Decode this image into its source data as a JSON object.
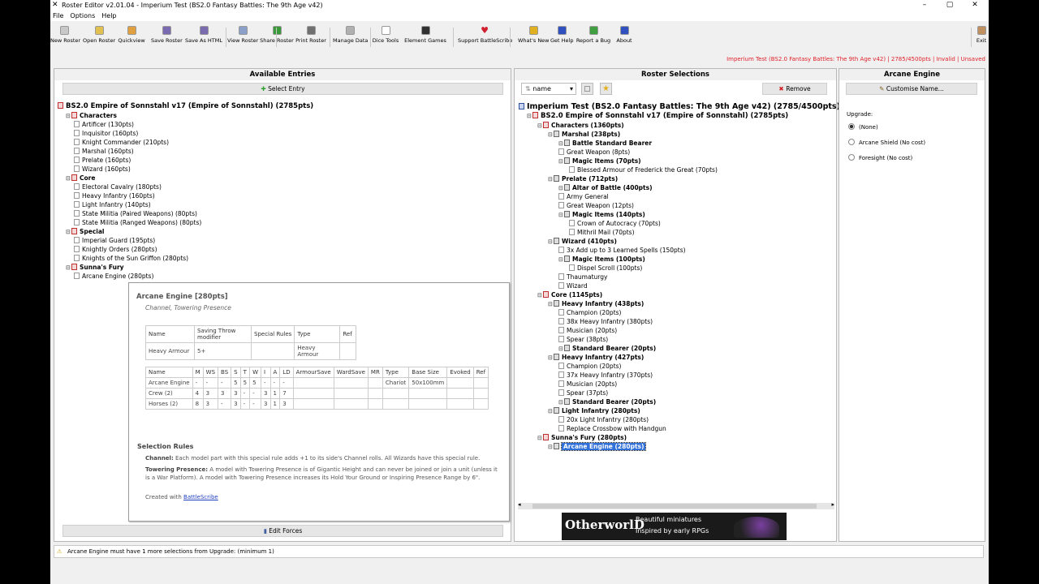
{
  "window": {
    "title": "Roster Editor v2.01.04 - Imperium Test (BS2.0 Fantasy Battles: The 9th Age v42)"
  },
  "menu": [
    "File",
    "Options",
    "Help"
  ],
  "toolbar": [
    {
      "label": "New Roster",
      "icon": "new-roster-icon",
      "color": "#c8c8c8"
    },
    {
      "label": "Open Roster",
      "icon": "folder-icon",
      "color": "#e2c050"
    },
    {
      "label": "Quickview",
      "icon": "quickview-icon",
      "color": "#e0a040"
    },
    {
      "label": "Save Roster",
      "icon": "save-icon",
      "color": "#7a6ab0"
    },
    {
      "label": "Save As HTML",
      "icon": "save-html-icon",
      "color": "#7a6ab0"
    },
    {
      "label": "View Roster",
      "icon": "view-roster-icon",
      "color": "#8aa0c8"
    },
    {
      "label": "Share Roster",
      "icon": "share-icon",
      "color": "#3a9a3a"
    },
    {
      "label": "Print Roster",
      "icon": "print-icon",
      "color": "#707070"
    },
    {
      "label": "Manage Data",
      "icon": "manage-data-icon",
      "color": "#b0b0b0"
    },
    {
      "label": "Dice Tools",
      "icon": "dice-icon",
      "color": "#ffffff"
    },
    {
      "label": "Element Games",
      "icon": "element-games-icon",
      "color": "#303030"
    },
    {
      "label": "Support BattleScribe",
      "icon": "heart-icon",
      "color": "#d02030"
    },
    {
      "label": "What's New",
      "icon": "whats-new-icon",
      "color": "#e0b020"
    },
    {
      "label": "Get Help",
      "icon": "help-icon",
      "color": "#3050c0"
    },
    {
      "label": "Report a Bug",
      "icon": "bug-icon",
      "color": "#40a040"
    },
    {
      "label": "About",
      "icon": "about-icon",
      "color": "#3050c0"
    },
    {
      "label": "Exit",
      "icon": "exit-icon",
      "color": "#c09060"
    }
  ],
  "status": "Imperium Test (BS2.0 Fantasy Battles: The 9th Age v42) | 2785/4500pts | Invalid | Unsaved",
  "available": {
    "header": "Available Entries",
    "select_button": "Select Entry",
    "root": "BS2.0 Empire of Sonnstahl v17 (Empire of Sonnstahl) (2785pts)",
    "rows": [
      {
        "text": "Characters",
        "bold": true,
        "indent": 1
      },
      {
        "text": "Artificer (130pts)",
        "indent": 2
      },
      {
        "text": "Inquisitor (160pts)",
        "indent": 2
      },
      {
        "text": "Knight Commander (210pts)",
        "indent": 2
      },
      {
        "text": "Marshal (160pts)",
        "indent": 2
      },
      {
        "text": "Prelate (160pts)",
        "indent": 2
      },
      {
        "text": "Wizard (160pts)",
        "indent": 2
      },
      {
        "text": "Core",
        "bold": true,
        "indent": 1
      },
      {
        "text": "Electoral Cavalry (180pts)",
        "indent": 2
      },
      {
        "text": "Heavy Infantry (160pts)",
        "indent": 2
      },
      {
        "text": "Light Infantry (140pts)",
        "indent": 2
      },
      {
        "text": "State Militia (Paired Weapons) (80pts)",
        "indent": 2
      },
      {
        "text": "State Militia (Ranged Weapons) (80pts)",
        "indent": 2
      },
      {
        "text": "Special",
        "bold": true,
        "indent": 1
      },
      {
        "text": "Imperial Guard (195pts)",
        "indent": 2
      },
      {
        "text": "Knightly Orders (280pts)",
        "indent": 2
      },
      {
        "text": "Knights of the Sun Griffon (280pts)",
        "indent": 2
      },
      {
        "text": "Sunna's Fury",
        "bold": true,
        "indent": 1
      },
      {
        "text": "Arcane Engine (280pts)",
        "indent": 2
      }
    ],
    "edit_forces": "Edit Forces"
  },
  "tooltip": {
    "title": "Arcane Engine [280pts]",
    "subtitle": "Channel, Towering Presence",
    "armour_headers": [
      "Name",
      "Saving Throw modifier",
      "Special Rules",
      "Type",
      "Ref"
    ],
    "armour_row": [
      "Heavy Armour",
      "5+",
      "",
      "Heavy Armour",
      ""
    ],
    "model_headers": [
      "Name",
      "M",
      "WS",
      "BS",
      "S",
      "T",
      "W",
      "I",
      "A",
      "LD",
      "ArmourSave",
      "WardSave",
      "MR",
      "Type",
      "Base Size",
      "Evoked",
      "Ref"
    ],
    "model_rows": [
      [
        "Arcane Engine",
        "-",
        "-",
        "-",
        "5",
        "5",
        "5",
        "-",
        "-",
        "-",
        "",
        "",
        "",
        "Chariot",
        "50x100mm",
        "",
        ""
      ],
      [
        "Crew (2)",
        "4",
        "3",
        "3",
        "3",
        "-",
        "-",
        "3",
        "1",
        "7",
        "",
        "",
        "",
        "",
        "",
        "",
        ""
      ],
      [
        "Horses (2)",
        "8",
        "3",
        "-",
        "3",
        "-",
        "-",
        "3",
        "1",
        "3",
        "",
        "",
        "",
        "",
        "",
        "",
        ""
      ]
    ],
    "rules_header": "Selection Rules",
    "rules": [
      {
        "name": "Channel:",
        "text": " Each model part with this special rule adds +1 to its side's Channel rolls. All Wizards have this special rule."
      },
      {
        "name": "Towering Presence:",
        "text": " A model with Towering Presence is of Gigantic Height and can never be joined or join a unit (unless it is a War Platform). A model with Towering Presence increases its Hold Your Ground or Inspiring Presence Range by 6\"."
      }
    ],
    "created_with": "Created with",
    "created_link": "BattleScribe"
  },
  "roster": {
    "header": "Roster Selections",
    "sort_value": "name",
    "remove_button": "Remove",
    "title": "Imperium Test (BS2.0 Fantasy Battles: The 9th Age v42) (2785/4500pts)",
    "force": "BS2.0 Empire of Sonnstahl v17 (Empire of Sonnstahl) (2785pts)",
    "rows": [
      {
        "text": "Characters (1360pts)",
        "bold": true,
        "indent": 1
      },
      {
        "text": "Marshal (238pts)",
        "bold": true,
        "indent": 2
      },
      {
        "text": "Battle Standard Bearer",
        "bold": true,
        "indent": 3
      },
      {
        "text": "Great Weapon (8pts)",
        "indent": 3
      },
      {
        "text": "Magic Items (70pts)",
        "bold": true,
        "indent": 3
      },
      {
        "text": "Blessed Armour of Frederick the Great (70pts)",
        "indent": 4
      },
      {
        "text": "Prelate (712pts)",
        "bold": true,
        "indent": 2
      },
      {
        "text": "Altar of Battle (400pts)",
        "bold": true,
        "indent": 3
      },
      {
        "text": "Army General",
        "indent": 3
      },
      {
        "text": "Great Weapon (12pts)",
        "indent": 3
      },
      {
        "text": "Magic Items (140pts)",
        "bold": true,
        "indent": 3
      },
      {
        "text": "Crown of Autocracy (70pts)",
        "indent": 4
      },
      {
        "text": "Mithril Mail (70pts)",
        "indent": 4
      },
      {
        "text": "Wizard (410pts)",
        "bold": true,
        "indent": 2
      },
      {
        "text": "3x Add up to 3 Learned Spells (150pts)",
        "indent": 3
      },
      {
        "text": "Magic Items (100pts)",
        "bold": true,
        "indent": 3
      },
      {
        "text": "Dispel Scroll (100pts)",
        "indent": 4
      },
      {
        "text": "Thaumaturgy",
        "indent": 3
      },
      {
        "text": "Wizard",
        "indent": 3
      },
      {
        "text": "Core (1145pts)",
        "bold": true,
        "indent": 1
      },
      {
        "text": "Heavy Infantry (438pts)",
        "bold": true,
        "indent": 2
      },
      {
        "text": "Champion (20pts)",
        "indent": 3
      },
      {
        "text": "38x Heavy Infantry (380pts)",
        "indent": 3
      },
      {
        "text": "Musician (20pts)",
        "indent": 3
      },
      {
        "text": "Spear (38pts)",
        "indent": 3
      },
      {
        "text": "Standard Bearer (20pts)",
        "bold": true,
        "indent": 3
      },
      {
        "text": "Heavy Infantry (427pts)",
        "bold": true,
        "indent": 2
      },
      {
        "text": "Champion (20pts)",
        "indent": 3
      },
      {
        "text": "37x Heavy Infantry (370pts)",
        "indent": 3
      },
      {
        "text": "Musician (20pts)",
        "indent": 3
      },
      {
        "text": "Spear (37pts)",
        "indent": 3
      },
      {
        "text": "Standard Bearer (20pts)",
        "bold": true,
        "indent": 3
      },
      {
        "text": "Light Infantry (280pts)",
        "bold": true,
        "indent": 2
      },
      {
        "text": "20x Light Infantry (280pts)",
        "indent": 3
      },
      {
        "text": "Replace Crossbow with Handgun",
        "indent": 3
      },
      {
        "text": "Sunna's Fury (280pts)",
        "bold": true,
        "indent": 1
      },
      {
        "text": "Arcane Engine (280pts)",
        "bold": true,
        "indent": 2,
        "selected": true
      }
    ]
  },
  "ad": {
    "brand": "OtherworlD",
    "line1": "Beautiful miniatures",
    "line2": "Inspired by early RPGs"
  },
  "detail": {
    "header": "Arcane Engine",
    "customise_button": "Customise Name...",
    "upgrade_label": "Upgrade:",
    "options": [
      {
        "label": "(None)",
        "checked": true
      },
      {
        "label": "Arcane Shield (No cost)",
        "checked": false
      },
      {
        "label": "Foresight (No cost)",
        "checked": false
      }
    ]
  },
  "warning": "Arcane Engine must have 1 more selections from Upgrade: (minimum 1)"
}
